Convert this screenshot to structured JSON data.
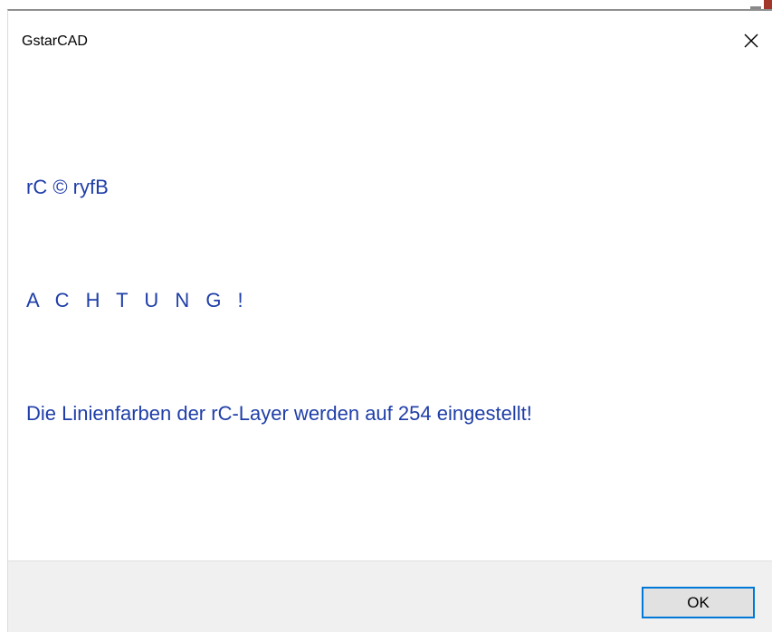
{
  "window": {
    "title": "GstarCAD"
  },
  "message": {
    "line1": "rC © ryfB",
    "line2": "A C H T U N G !",
    "line3": "Die Linienfarben der rC-Layer werden auf 254 eingestellt!"
  },
  "buttons": {
    "ok_label": "OK"
  },
  "icons": {
    "close": "close-icon"
  },
  "colors": {
    "message_text": "#1f3ea8",
    "button_focus_border": "#0078d7",
    "footer_background": "#f0f0f0"
  }
}
